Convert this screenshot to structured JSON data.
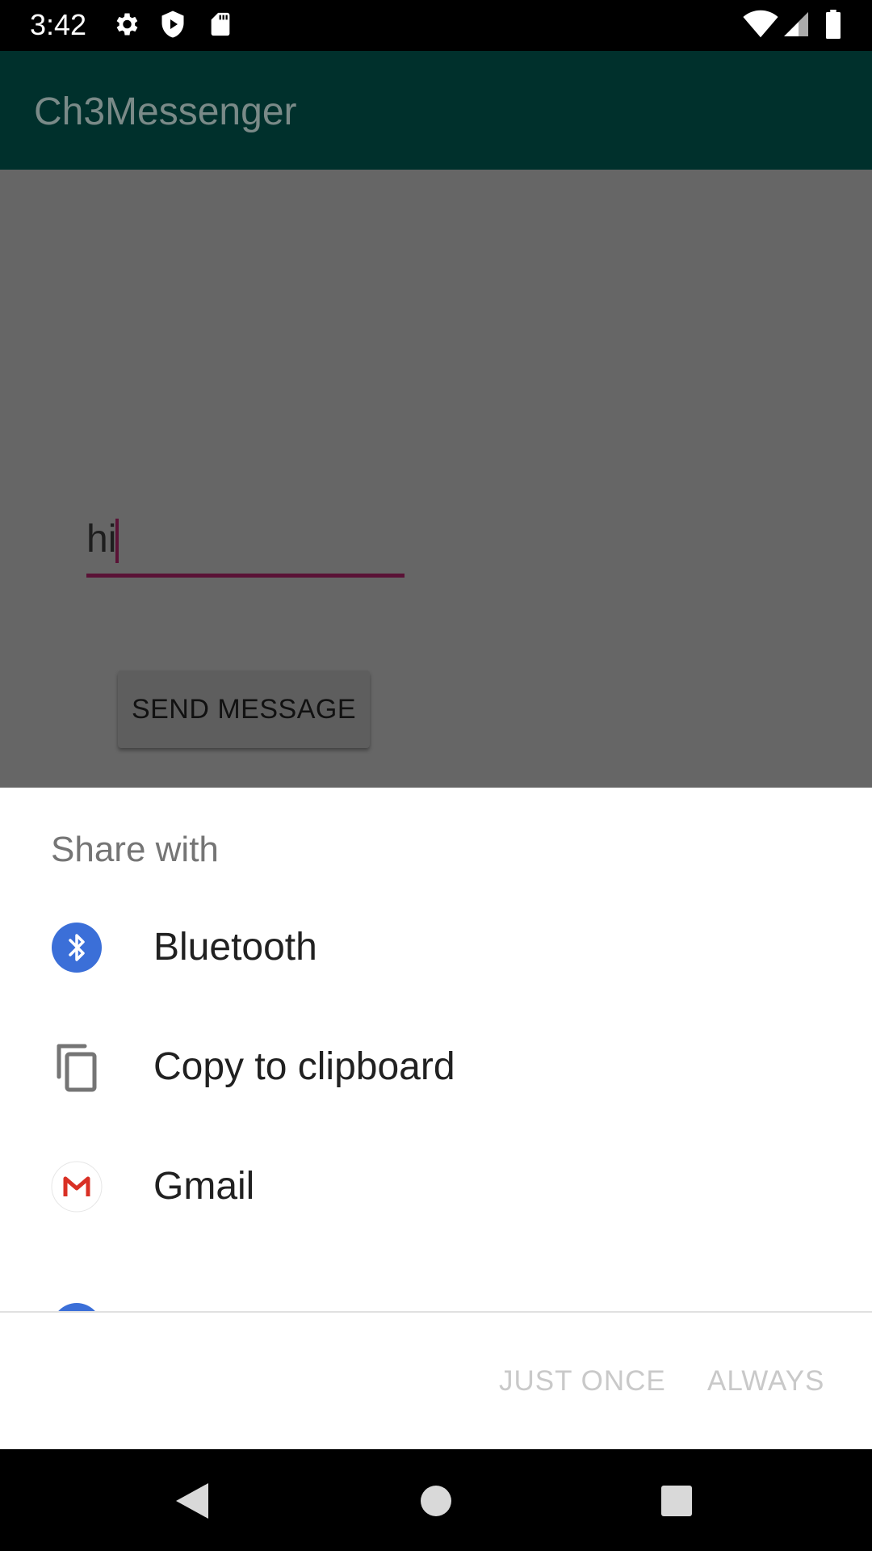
{
  "status_bar": {
    "time": "3:42",
    "left_icons": [
      "settings-icon",
      "shield-play-icon",
      "sd-card-icon"
    ],
    "right_icons": [
      "wifi-icon",
      "cell-signal-icon",
      "battery-icon"
    ]
  },
  "app_bar": {
    "title": "Ch3Messenger"
  },
  "main": {
    "message_input": {
      "value": "hi"
    },
    "send_button": {
      "label": "SEND MESSAGE"
    }
  },
  "share_sheet": {
    "title": "Share with",
    "options": [
      {
        "label": "Bluetooth",
        "icon": "bluetooth-icon"
      },
      {
        "label": "Copy to clipboard",
        "icon": "copy-icon"
      },
      {
        "label": "Gmail",
        "icon": "gmail-icon"
      }
    ],
    "just_once_label": "JUST ONCE",
    "always_label": "ALWAYS"
  },
  "nav_bar": {
    "icons": [
      "back-icon",
      "home-icon",
      "recents-icon"
    ]
  },
  "colors": {
    "scrim_overlay": "#666666",
    "app_bar": "#00302c",
    "accent": "#5a1236",
    "bluetooth": "#3b6fd8",
    "gmail_red": "#d93025",
    "disabled_button": "#c9c9c9"
  }
}
